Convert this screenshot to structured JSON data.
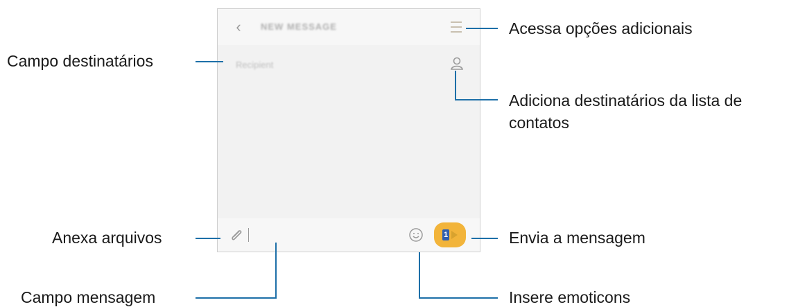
{
  "app": {
    "title": "NEW MESSAGE",
    "back_icon": "chevron-left-icon",
    "menu_icon": "menu-icon"
  },
  "recipient": {
    "placeholder": "Recipient",
    "contact_icon": "person-icon"
  },
  "composer": {
    "attach_icon": "paperclip-icon",
    "emoji_icon": "smiley-icon",
    "send_icon": "send-icon",
    "send_sim_label": "1",
    "send_color": "#f2b43a"
  },
  "callouts": {
    "menu": "Acessa opções adicionais",
    "recipient_field": "Campo destinatários",
    "add_contacts_line1": "Adiciona destinatários da lista de",
    "add_contacts_line2": "contatos",
    "attach": "Anexa arquivos",
    "send": "Envia a mensagem",
    "message_field": "Campo mensagem",
    "emoticons": "Insere emoticons"
  },
  "colors": {
    "callout_line": "#1d6fa8",
    "screen_bg": "#f2f2f2"
  }
}
